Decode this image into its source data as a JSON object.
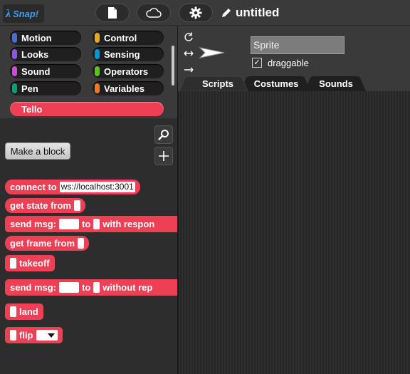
{
  "app": {
    "name": "Snap!",
    "project_title": "untitled"
  },
  "toolbar": {
    "file_icon": "file-icon",
    "cloud_icon": "cloud-icon",
    "settings_icon": "gear-icon",
    "edit_icon": "pencil-icon"
  },
  "categories": [
    {
      "label": "Motion",
      "color": "#4a6cd4"
    },
    {
      "label": "Control",
      "color": "#e6a822"
    },
    {
      "label": "Looks",
      "color": "#8f56e3"
    },
    {
      "label": "Sensing",
      "color": "#0494dc"
    },
    {
      "label": "Sound",
      "color": "#cf4ad9"
    },
    {
      "label": "Operators",
      "color": "#62c213"
    },
    {
      "label": "Pen",
      "color": "#00a178"
    },
    {
      "label": "Variables",
      "color": "#f3761d"
    }
  ],
  "custom_category": {
    "label": "Tello",
    "color": "#ee4055"
  },
  "palette": {
    "make_block_label": "Make a block",
    "blocks": [
      {
        "text": "connect to",
        "input": "ws://localhost:3001"
      },
      {
        "text": "get state from"
      },
      {
        "text_a": "send msg:",
        "text_b": "to",
        "text_c": "with respon"
      },
      {
        "text": "get frame from"
      },
      {
        "text": "takeoff"
      },
      {
        "text_a": "send msg:",
        "text_b": "to",
        "text_c": "without rep"
      },
      {
        "text": "land"
      },
      {
        "text": "flip"
      }
    ]
  },
  "sprite": {
    "name": "Sprite",
    "draggable_label": "draggable",
    "draggable_checked": "✓"
  },
  "tabs": [
    {
      "label": "Scripts"
    },
    {
      "label": "Costumes"
    },
    {
      "label": "Sounds"
    }
  ]
}
